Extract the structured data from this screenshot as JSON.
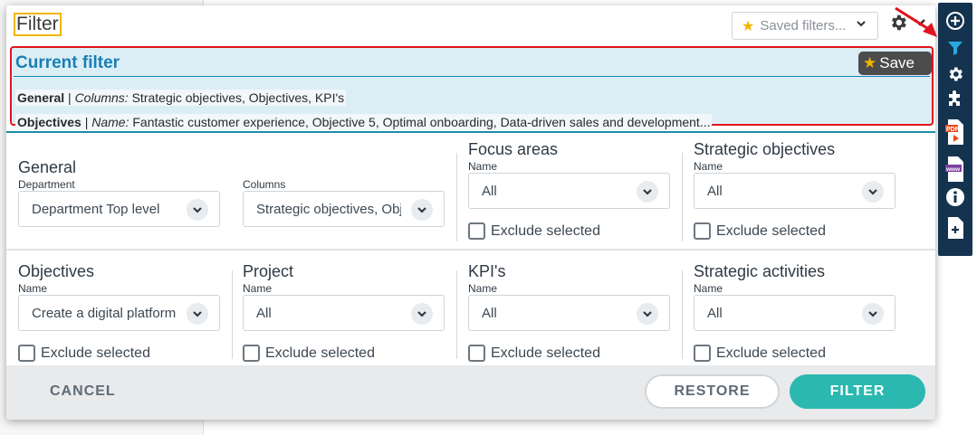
{
  "dialog": {
    "title": "Filter",
    "saved_filters_placeholder": "Saved filters..."
  },
  "current_filter": {
    "title": "Current filter",
    "save_label": "Save",
    "line1_group": "General",
    "line1_sep": " | ",
    "line1_key": "Columns:",
    "line1_value": " Strategic objectives, Objectives, KPI's",
    "line2_group": "Objectives",
    "line2_sep": " | ",
    "line2_key": "Name:",
    "line2_value": " Fantastic customer experience, Objective 5, Optimal onboarding, Data-driven sales and development..."
  },
  "general": {
    "title": "General",
    "department_label": "Department",
    "department_value": "Department Top level",
    "columns_label": "Columns",
    "columns_value": "Strategic objectives, Objectives, KPI's"
  },
  "focus_areas": {
    "title": "Focus areas",
    "name_label": "Name",
    "name_value": "All",
    "exclude_label": "Exclude selected"
  },
  "strategic_objectives": {
    "title": "Strategic objectives",
    "name_label": "Name",
    "name_value": "All",
    "exclude_label": "Exclude selected"
  },
  "objectives": {
    "title": "Objectives",
    "name_label": "Name",
    "name_value": "Create a digital platform",
    "exclude_label": "Exclude selected"
  },
  "project": {
    "title": "Project",
    "name_label": "Name",
    "name_value": "All",
    "exclude_label": "Exclude selected"
  },
  "kpis": {
    "title": "KPI's",
    "name_label": "Name",
    "name_value": "All",
    "exclude_label": "Exclude selected"
  },
  "strategic_activities": {
    "title": "Strategic activities",
    "name_label": "Name",
    "name_value": "All",
    "exclude_label": "Exclude selected"
  },
  "footer": {
    "cancel_label": "CANCEL",
    "restore_label": "RESTORE",
    "filter_label": "FILTER"
  },
  "toolbar": {
    "icons": [
      "add-circle-icon",
      "filter-icon",
      "gear-icon",
      "puzzle-icon",
      "pdf-export-icon",
      "www-export-icon",
      "info-icon",
      "new-document-icon"
    ]
  },
  "colors": {
    "accent": "#1a7fb5",
    "teal": "#2ab8b0",
    "toolbar": "#13334f",
    "highlight_border": "#e0141e",
    "star": "#f2b500"
  }
}
